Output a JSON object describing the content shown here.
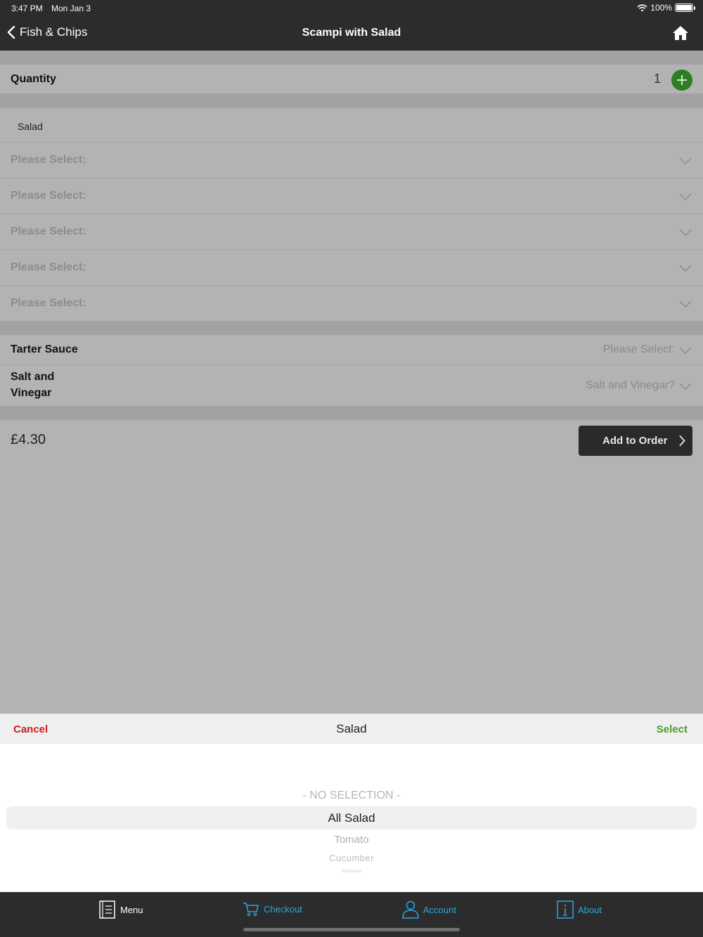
{
  "status": {
    "time": "3:47 PM",
    "date": "Mon Jan 3",
    "battery": "100%"
  },
  "nav": {
    "back_label": "Fish & Chips",
    "title": "Scampi with Salad"
  },
  "quantity": {
    "label": "Quantity",
    "value": "1"
  },
  "salad": {
    "header": "Salad",
    "selects": [
      "Please Select:",
      "Please Select:",
      "Please Select:",
      "Please Select:",
      "Please Select:"
    ]
  },
  "tarter": {
    "label": "Tarter Sauce",
    "placeholder": "Please Select:"
  },
  "salt": {
    "label_line1": "Salt and",
    "label_line2": "Vinegar",
    "placeholder": "Salt and Vinegar?"
  },
  "order": {
    "price": "£4.30",
    "add_label": "Add to Order"
  },
  "picker": {
    "cancel": "Cancel",
    "title": "Salad",
    "select": "Select",
    "options": [
      "- NO SELECTION -",
      "All Salad",
      "Tomato",
      "Cucumber",
      "Onion"
    ],
    "selected": "All Salad"
  },
  "tabs": [
    {
      "label": "Menu",
      "icon": "menu-book-icon",
      "color": "#ffffff"
    },
    {
      "label": "Checkout",
      "icon": "cart-icon",
      "color": "#29a8e0"
    },
    {
      "label": "Account",
      "icon": "person-icon",
      "color": "#29a8e0"
    },
    {
      "label": "About",
      "icon": "info-icon",
      "color": "#29a8e0"
    }
  ],
  "colors": {
    "accent_green": "#2e7d24",
    "cancel_red": "#cc1d1d",
    "select_green": "#4a9c2f",
    "tab_blue": "#29a8e0"
  }
}
